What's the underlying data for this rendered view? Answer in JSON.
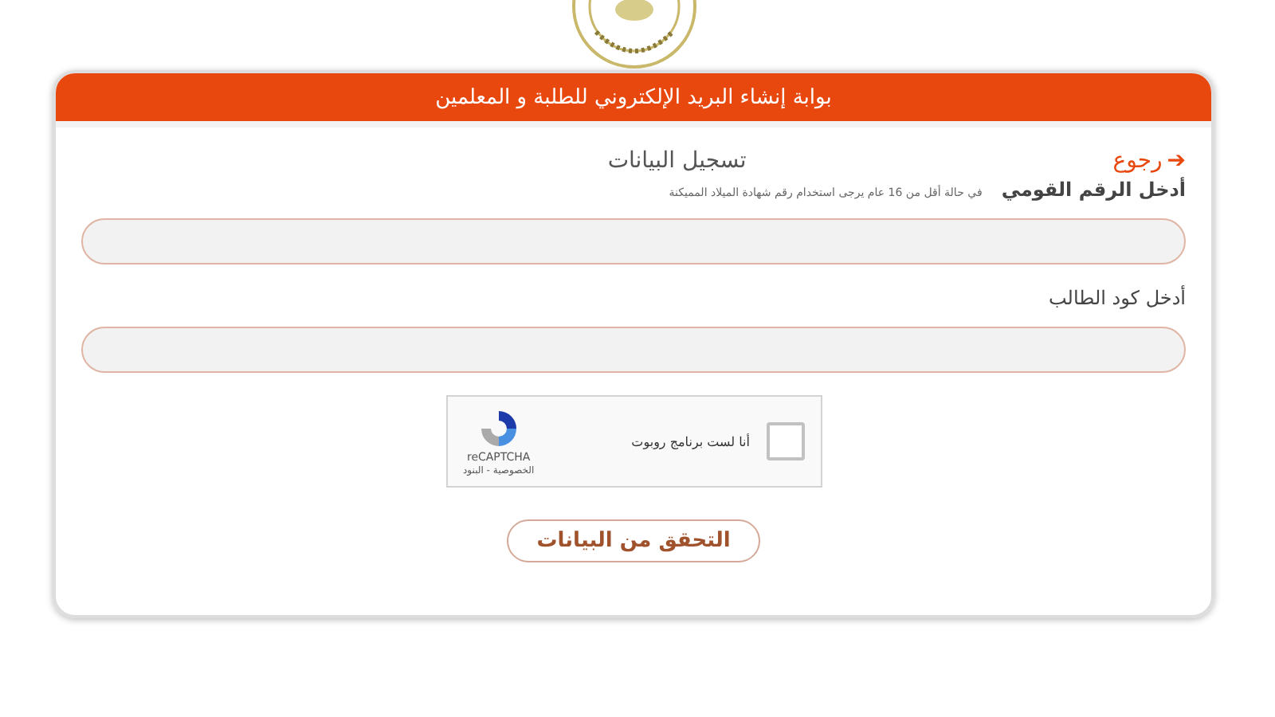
{
  "header": {
    "title": "بوابة إنشاء البريد الإلكتروني للطلبة و المعلمين"
  },
  "back_link": {
    "icon": "➔",
    "label": "رجوع"
  },
  "form_title": "تسجيل البيانات",
  "fields": [
    {
      "label": "أدخل الرقم القومي",
      "hint": "في حالة أقل من 16 عام يرجى استخدام رقم شهادة الميلاد المميكنة"
    },
    {
      "label": "أدخل كود الطالب"
    }
  ],
  "captcha": {
    "label": "أنا لست برنامج روبوت",
    "checked": false,
    "brand": "reCAPTCHA",
    "links": "الخصوصية - البنود"
  },
  "submit": "التحقق من البيانات"
}
